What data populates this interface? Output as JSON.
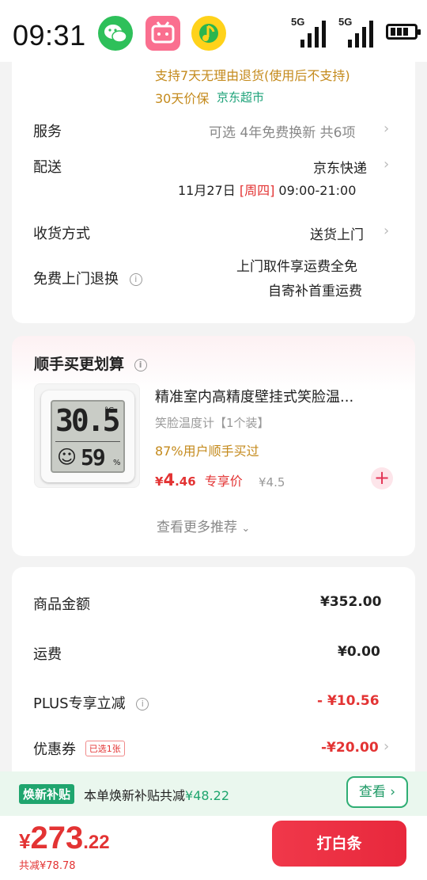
{
  "status_bar": {
    "time": "09:31",
    "network1": "5G",
    "network2": "5G"
  },
  "delivery_card": {
    "return_policy": "支持7天无理由退货(使用后不支持)",
    "price_protect": "30天价保",
    "store": "京东超市",
    "service_label": "服务",
    "service_value": "可选 4年免费换新 共6项",
    "shipping_label": "配送",
    "shipping_value": "京东快递",
    "ship_date": "11月27日",
    "ship_weekday": "[周四]",
    "ship_time": "09:00-21:00",
    "receive_label": "收货方式",
    "receive_value": "送货上门",
    "free_return_label": "免费上门退换",
    "free_return_line1": "上门取件享运费全免",
    "free_return_line2": "自寄补首重运费"
  },
  "addon_card": {
    "title": "顺手买更划算",
    "product_name": "精准室内高精度壁挂式笑脸温...",
    "product_spec": "笑脸温度计【1个装】",
    "social_proof": "87%用户顺手买过",
    "price_symbol": "¥",
    "price_int": "4",
    "price_dec": ".46",
    "price_tag": "专享价",
    "original_price": "¥4.5",
    "more": "查看更多推荐",
    "thumb_temp": "30.5",
    "thumb_unit": "°C",
    "thumb_hum": "59",
    "thumb_pct": "%"
  },
  "summary_card": {
    "goods_label": "商品金额",
    "goods_value": "¥352.00",
    "freight_label": "运费",
    "freight_value": "¥0.00",
    "plus_label": "PLUS专享立减",
    "plus_value": "- ¥10.56",
    "coupon_label": "优惠券",
    "coupon_tag": "已选1张",
    "coupon_value": "-¥20.00"
  },
  "subsidy_bar": {
    "tag": "焕新补贴",
    "text": "本单焕新补贴共减",
    "amount": "¥48.22",
    "button": "查看"
  },
  "bottom_bar": {
    "currency": "¥",
    "total_int": "273",
    "total_dec": ".22",
    "saved": "共减¥78.78",
    "pay_button": "打白条"
  },
  "colors": {
    "accent_red": "#e33333",
    "gold": "#c48a1c",
    "green": "#1fa56e"
  }
}
